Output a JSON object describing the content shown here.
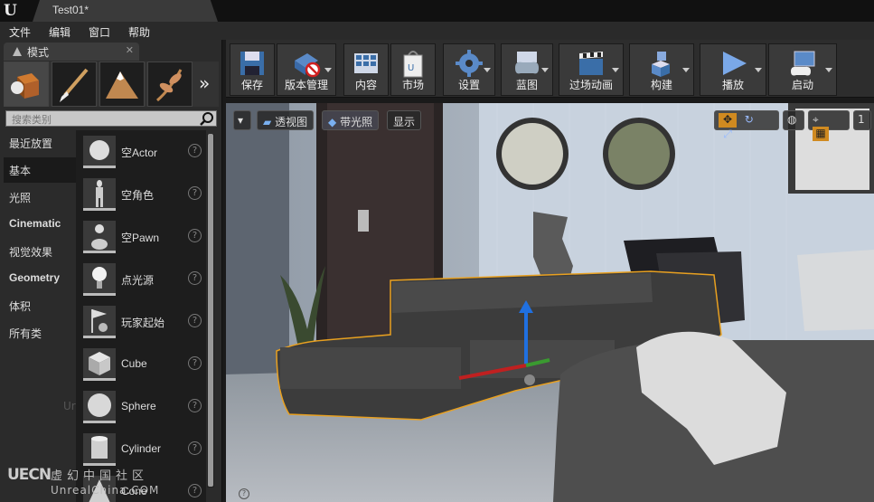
{
  "window": {
    "tab_title": "Test01*"
  },
  "menu": [
    "文件",
    "编辑",
    "窗口",
    "帮助"
  ],
  "modes_panel": {
    "tab_label": "模式",
    "search_placeholder": "搜索类别",
    "categories": [
      {
        "label": "最近放置",
        "bold": false
      },
      {
        "label": "基本",
        "bold": false,
        "active": true
      },
      {
        "label": "光照",
        "bold": false
      },
      {
        "label": "Cinematic",
        "bold": true
      },
      {
        "label": "视觉效果",
        "bold": false
      },
      {
        "label": "Geometry",
        "bold": true
      },
      {
        "label": "体积",
        "bold": false
      },
      {
        "label": "所有类",
        "bold": false
      }
    ],
    "items": [
      "空Actor",
      "空角色",
      "空Pawn",
      "点光源",
      "玩家起始",
      "Cube",
      "Sphere",
      "Cylinder",
      "Cone"
    ],
    "help_glyph": "?"
  },
  "toolbar": {
    "buttons": [
      "保存",
      "版本管理",
      "内容",
      "市场",
      "设置",
      "蓝图",
      "过场动画",
      "构建",
      "播放",
      "启动"
    ]
  },
  "viewport": {
    "perspective_label": "透视图",
    "lit_label": "带光照",
    "show_label": "显示"
  },
  "watermark": {
    "logo_text": "UECN",
    "cn_text": "虚幻中国社区",
    "url_text": "UnrealChina.COM",
    "faint_text": "Ur"
  },
  "colors": {
    "accent_orange": "#e8a020",
    "panel_bg": "#2b2b2b",
    "toolbar_button": "#3a3a3a"
  }
}
